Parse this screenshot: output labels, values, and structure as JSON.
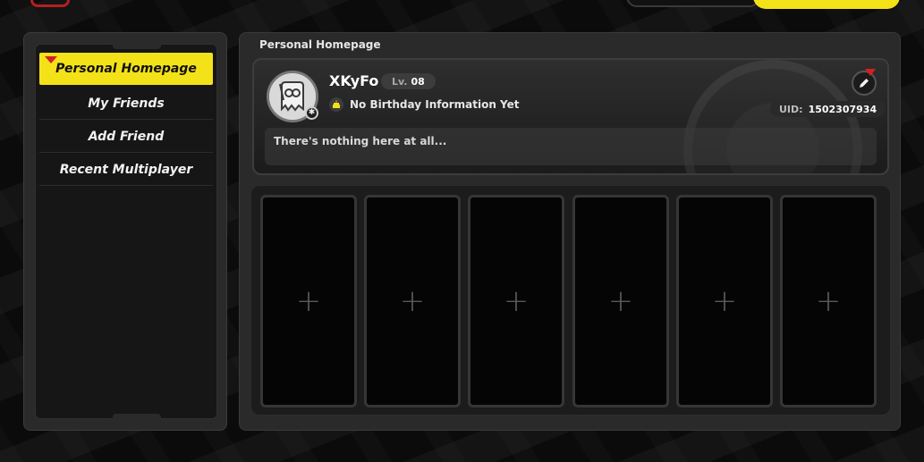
{
  "sidebar": {
    "items": [
      {
        "label": "Personal Homepage",
        "active": true
      },
      {
        "label": "My Friends",
        "active": false
      },
      {
        "label": "Add Friend",
        "active": false
      },
      {
        "label": "Recent Multiplayer",
        "active": false
      }
    ]
  },
  "main": {
    "section_title": "Personal Homepage",
    "profile": {
      "username": "XKyFo",
      "level_prefix": "Lv.",
      "level": "08",
      "birthday": "No Birthday Information Yet",
      "uid_label": "UID:",
      "uid": "1502307934",
      "signature": "There's nothing here at all..."
    },
    "slots": [
      {
        "symbol": "+"
      },
      {
        "symbol": "+"
      },
      {
        "symbol": "+"
      },
      {
        "symbol": "+"
      },
      {
        "symbol": "+"
      },
      {
        "symbol": "+"
      }
    ]
  },
  "colors": {
    "accent_yellow": "#f4e219",
    "alert_red": "#d61f1f",
    "panel": "#2a2a2a"
  },
  "icons": {
    "edit": "pencil-icon",
    "birthday": "cake-icon",
    "avatar_badge": "gear-icon"
  }
}
